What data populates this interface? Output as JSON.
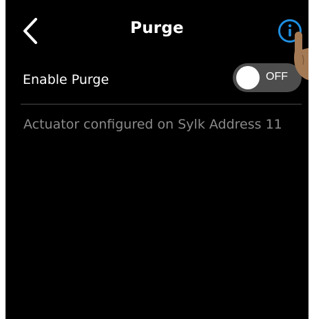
{
  "header": {
    "title": "Purge",
    "back_icon": "chevron-left-icon",
    "info_icon": "info-icon"
  },
  "purge": {
    "label": "Enable Purge",
    "toggle_state": "OFF",
    "enabled": false
  },
  "status": {
    "message": "Actuator configured on Sylk Address 11"
  },
  "colors": {
    "background": "#000000",
    "text": "#ffffff",
    "muted_text": "#8a8a8a",
    "accent": "#1f8fe0",
    "toggle_track": "#4d4d4d"
  }
}
